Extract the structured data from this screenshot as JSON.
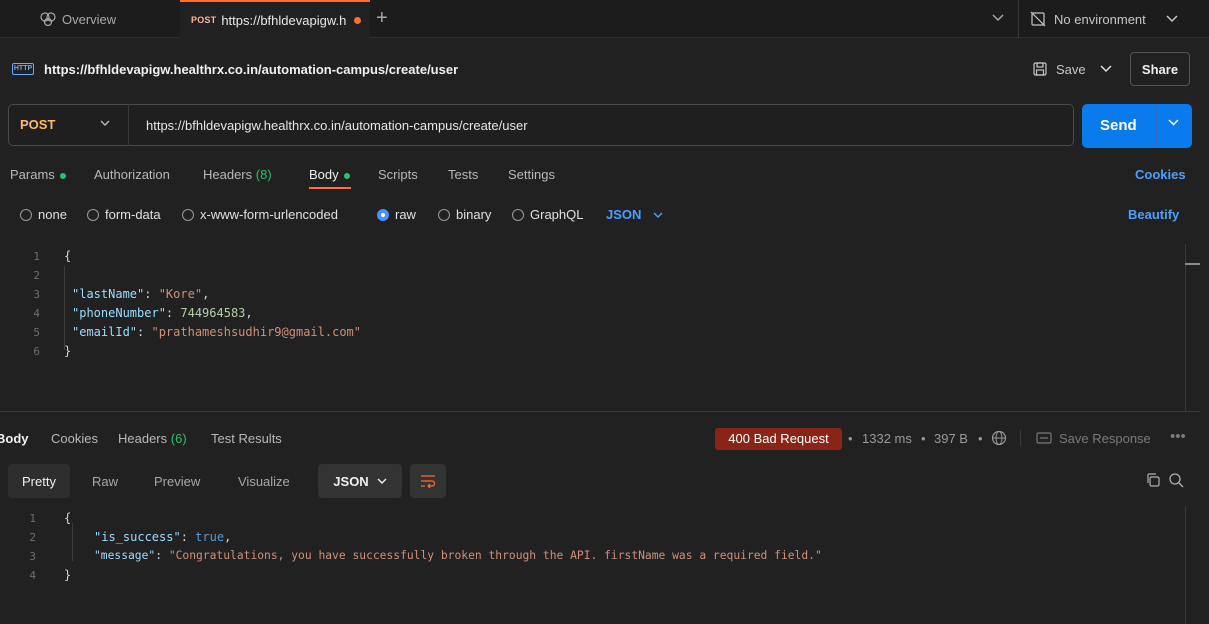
{
  "tabs": {
    "overview_label": "Overview",
    "active_method": "POST",
    "active_label": "https://bfhldevapigw.h",
    "new_tab": "+"
  },
  "environment": {
    "label": "No environment"
  },
  "request": {
    "title": "https://bfhldevapigw.healthrx.co.in/automation-campus/create/user",
    "save_label": "Save",
    "share_label": "Share",
    "method": "POST",
    "url": "https://bfhldevapigw.healthrx.co.in/automation-campus/create/user",
    "send_label": "Send"
  },
  "request_tabs": {
    "params": "Params",
    "authorization": "Authorization",
    "headers": "Headers",
    "headers_count": "(8)",
    "body": "Body",
    "scripts": "Scripts",
    "tests": "Tests",
    "settings": "Settings",
    "cookies": "Cookies"
  },
  "body_types": {
    "none": "none",
    "form_data": "form-data",
    "urlencoded": "x-www-form-urlencoded",
    "raw": "raw",
    "binary": "binary",
    "graphql": "GraphQL",
    "language": "JSON",
    "beautify": "Beautify",
    "selected": "raw"
  },
  "request_body": {
    "line_numbers": [
      "1",
      "2",
      "3",
      "4",
      "5",
      "6"
    ],
    "open_brace": "{",
    "close_brace": "}",
    "lines": [
      {
        "key": "\"lastName\"",
        "value": "\"Kore\"",
        "trail": ","
      },
      {
        "key": "\"phoneNumber\"",
        "value": "744964583",
        "trail": ","
      },
      {
        "key": "\"emailId\"",
        "value": "\"prathameshsudhir9@gmail.com\"",
        "trail": ""
      }
    ]
  },
  "response_tabs": {
    "body": "Body",
    "cookies": "Cookies",
    "headers": "Headers",
    "headers_count": "(6)",
    "test_results": "Test Results"
  },
  "response_meta": {
    "status": "400 Bad Request",
    "time": "1332 ms",
    "size": "397 B",
    "save_response": "Save Response",
    "status_color": "#8a2416"
  },
  "response_view": {
    "pretty": "Pretty",
    "raw": "Raw",
    "preview": "Preview",
    "visualize": "Visualize",
    "language": "JSON"
  },
  "response_body": {
    "line_numbers": [
      "1",
      "2",
      "3",
      "4"
    ],
    "open_brace": "{",
    "close_brace": "}",
    "lines": [
      {
        "key": "\"is_success\"",
        "value": "true",
        "trail": ","
      },
      {
        "key": "\"message\"",
        "value": "\"Congratulations, you have successfully broken through the API. firstName was a required field.\"",
        "trail": ""
      }
    ]
  },
  "colors": {
    "accent": "#ff6c37",
    "send": "#097bed",
    "link": "#4aa0ff",
    "method_post": "#ffb86b"
  },
  "icons": [
    "overview-icon",
    "http-icon",
    "save-icon",
    "no-environment-icon",
    "chevron-down-icon",
    "globe-icon",
    "save-response-icon",
    "more-icon",
    "wrap-icon",
    "copy-icon",
    "search-icon"
  ]
}
